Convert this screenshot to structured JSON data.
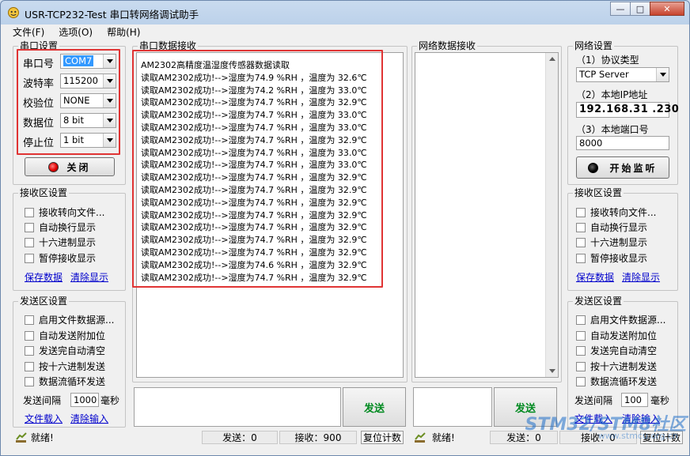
{
  "window": {
    "title": "USR-TCP232-Test 串口转网络调试助手",
    "minimize": "0",
    "maximize": "□",
    "close": "✕"
  },
  "menu": [
    "文件(F)",
    "选项(O)",
    "帮助(H)"
  ],
  "serial_settings": {
    "title": "串口设置",
    "port_label": "串口号",
    "port_value": "COM7",
    "baud_label": "波特率",
    "baud_value": "115200",
    "parity_label": "校验位",
    "parity_value": "NONE",
    "databits_label": "数据位",
    "databits_value": "8 bit",
    "stopbits_label": "停止位",
    "stopbits_value": "1 bit",
    "close_button": "关闭"
  },
  "serial_receive_settings": {
    "title": "接收区设置",
    "options": [
      "接收转向文件...",
      "自动换行显示",
      "十六进制显示",
      "暂停接收显示"
    ],
    "save_link": "保存数据",
    "clear_link": "清除显示"
  },
  "serial_send_settings": {
    "title": "发送区设置",
    "options": [
      "启用文件数据源...",
      "自动发送附加位",
      "发送完自动清空",
      "按十六进制发送",
      "数据流循环发送"
    ],
    "interval_label": "发送间隔",
    "interval_value": "1000",
    "interval_unit": "毫秒",
    "load_link": "文件载入",
    "clear_link": "清除输入"
  },
  "serial_receive": {
    "title": "串口数据接收",
    "lines": [
      "AM2302高精度温湿度传感器数据读取",
      "读取AM2302成功!-->湿度为74.9 %RH ，温度为 32.6℃",
      "读取AM2302成功!-->湿度为74.2 %RH ，温度为 33.0℃",
      "读取AM2302成功!-->湿度为74.7 %RH ，温度为 32.9℃",
      "读取AM2302成功!-->湿度为74.7 %RH ，温度为 33.0℃",
      "读取AM2302成功!-->湿度为74.7 %RH ，温度为 33.0℃",
      "读取AM2302成功!-->湿度为74.7 %RH ，温度为 32.9℃",
      "读取AM2302成功!-->湿度为74.7 %RH ，温度为 33.0℃",
      "读取AM2302成功!-->湿度为74.7 %RH ，温度为 33.0℃",
      "读取AM2302成功!-->湿度为74.7 %RH ，温度为 32.9℃",
      "读取AM2302成功!-->湿度为74.7 %RH ，温度为 32.9℃",
      "读取AM2302成功!-->湿度为74.7 %RH ，温度为 32.9℃",
      "读取AM2302成功!-->湿度为74.7 %RH ，温度为 32.9℃",
      "读取AM2302成功!-->湿度为74.7 %RH ，温度为 32.9℃",
      "读取AM2302成功!-->湿度为74.7 %RH ，温度为 32.9℃",
      "读取AM2302成功!-->湿度为74.7 %RH ，温度为 32.9℃",
      "读取AM2302成功!-->湿度为74.6 %RH ，温度为 32.9℃",
      "读取AM2302成功!-->湿度为74.7 %RH ，温度为 32.9℃"
    ]
  },
  "network_receive": {
    "title": "网络数据接收"
  },
  "network_settings": {
    "title": "网络设置",
    "protocol_label": "（1）协议类型",
    "protocol_value": "TCP Server",
    "ip_label": "（2）本地IP地址",
    "ip_value": "192.168.31 .230",
    "port_label": "（3）本地端口号",
    "port_value": "8000",
    "listen_button": "开始监听"
  },
  "network_receive_settings": {
    "title": "接收区设置",
    "options": [
      "接收转向文件...",
      "自动换行显示",
      "十六进制显示",
      "暂停接收显示"
    ],
    "save_link": "保存数据",
    "clear_link": "清除显示"
  },
  "network_send_settings": {
    "title": "发送区设置",
    "options": [
      "启用文件数据源...",
      "自动发送附加位",
      "发送完自动清空",
      "按十六进制发送",
      "数据流循环发送"
    ],
    "interval_label": "发送间隔",
    "interval_value": "100",
    "interval_unit": "毫秒",
    "load_link": "文件载入",
    "clear_link": "清除输入"
  },
  "send_button": "发送",
  "status_left": {
    "ready": "就绪!",
    "sent": "发送：0",
    "received": "接收：900",
    "reset": "复位计数"
  },
  "status_right": {
    "ready": "就绪!",
    "sent": "发送：0",
    "received": "接收：0",
    "reset": "复位计数"
  },
  "watermark": {
    "brand": "STM32/STM8社区",
    "url": "www.stmcu.org.cn"
  },
  "colors": {
    "highlight": "#e03434",
    "link": "#0000cc",
    "send_text": "#008a20",
    "selection": "#3399ff"
  }
}
